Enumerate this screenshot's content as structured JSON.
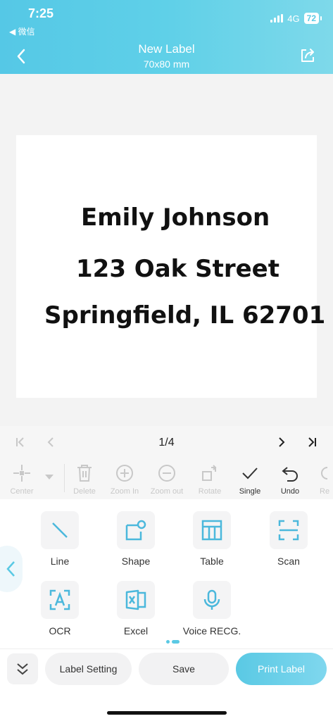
{
  "status": {
    "time": "7:25",
    "back_app": "◀ 微信",
    "network": "4G",
    "battery": "72"
  },
  "header": {
    "title": "New Label",
    "subtitle": "70x80 mm"
  },
  "label": {
    "lines": [
      "Emily Johnson",
      "123 Oak Street",
      "Springfield, IL 62701"
    ]
  },
  "pager": {
    "indicator": "1/4"
  },
  "toolbar": {
    "center": "Center",
    "delete": "Delete",
    "zoom_in": "Zoom In",
    "zoom_out": "Zoom out",
    "rotate": "Rotate",
    "single": "Single",
    "undo": "Undo",
    "redo": "Re"
  },
  "panel": {
    "tiles": [
      {
        "label": "Line",
        "icon": "line-icon"
      },
      {
        "label": "Shape",
        "icon": "shape-icon"
      },
      {
        "label": "Table",
        "icon": "table-icon"
      },
      {
        "label": "Scan",
        "icon": "scan-icon"
      },
      {
        "label": "OCR",
        "icon": "ocr-icon"
      },
      {
        "label": "Excel",
        "icon": "excel-icon"
      },
      {
        "label": "Voice RECG.",
        "icon": "microphone-icon"
      }
    ]
  },
  "bottom": {
    "label_setting": "Label Setting",
    "save": "Save",
    "print": "Print Label"
  },
  "colors": {
    "accent": "#5ac9e4",
    "disabled": "#c8c8c8"
  }
}
